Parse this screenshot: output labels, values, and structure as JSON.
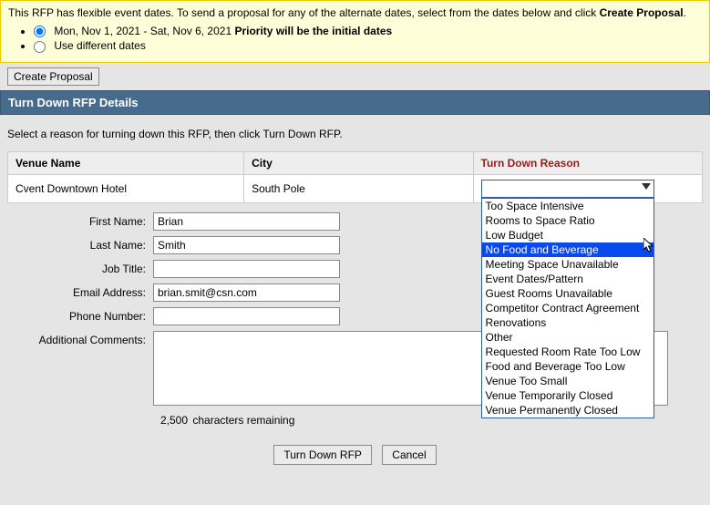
{
  "notice": {
    "prefix": "This RFP has flexible event dates. To send a proposal for any of the alternate dates, select from the dates below and click ",
    "bold": "Create Proposal",
    "suffix": "."
  },
  "radios": {
    "opt1_date": "Mon, Nov 1, 2021 - Sat, Nov 6, 2021 ",
    "opt1_bold": "Priority will be the initial dates",
    "opt2": "Use different dates"
  },
  "buttons": {
    "create_proposal": "Create Proposal",
    "turn_down": "Turn Down RFP",
    "cancel": "Cancel"
  },
  "section_header": "Turn Down RFP Details",
  "instruction": "Select a reason for turning down this RFP, then click Turn Down RFP.",
  "table": {
    "headers": {
      "venue": "Venue Name",
      "city": "City",
      "reason": "Turn Down Reason"
    },
    "row": {
      "venue": "Cvent Downtown Hotel",
      "city": "South Pole"
    }
  },
  "dropdown": {
    "options": [
      "Too Space Intensive",
      "Rooms to Space Ratio",
      "Low Budget",
      "No Food and Beverage",
      "Meeting Space Unavailable",
      "Event Dates/Pattern",
      "Guest Rooms Unavailable",
      "Competitor Contract Agreement",
      "Renovations",
      "Other",
      "Requested Room Rate Too Low",
      "Food and Beverage Too Low",
      "Venue Too Small",
      "Venue Temporarily Closed",
      "Venue Permanently Closed"
    ],
    "highlighted_index": 3
  },
  "form": {
    "labels": {
      "first_name": "First Name:",
      "last_name": "Last Name:",
      "job_title": "Job Title:",
      "email": "Email Address:",
      "phone": "Phone Number:",
      "comments": "Additional Comments:"
    },
    "values": {
      "first_name": "Brian",
      "last_name": "Smith",
      "job_title": "",
      "email": "brian.smit@csn.com",
      "phone": "",
      "comments": ""
    }
  },
  "char_count": "2,500",
  "char_label": "characters remaining"
}
